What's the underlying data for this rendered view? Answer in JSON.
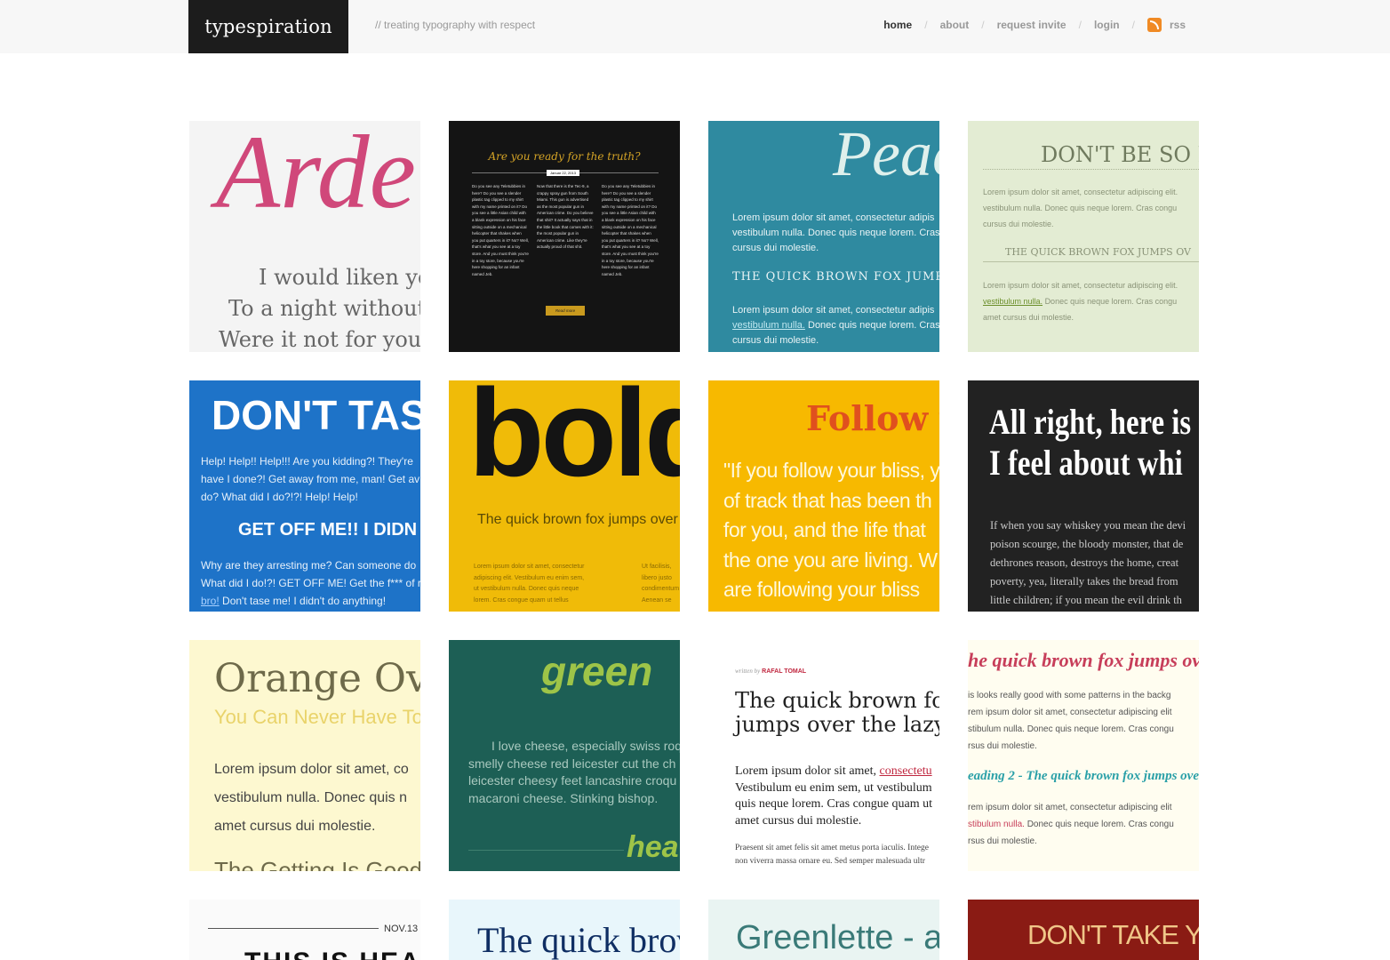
{
  "header": {
    "logo": "typespiration",
    "tagline": "// treating typography with respect",
    "nav": [
      {
        "label": "home"
      },
      {
        "label": "about"
      },
      {
        "label": "request invite"
      },
      {
        "label": "login"
      },
      {
        "label": "rss",
        "icon": "rss-icon"
      }
    ],
    "separator": "/"
  },
  "tiles": {
    "t1": {
      "title": "Ardel",
      "lines": [
        "I would liken yo",
        "To a night without",
        "Were it not for your"
      ],
      "bg": "#f4f4f4",
      "accent": "#d0487a"
    },
    "t2": {
      "title": "Are you ready for the truth?",
      "date": "Januar 22, 2013",
      "col1": "Do you see any Teletubbies in here? Do you see a slender plastic tag clipped to my shirt with my name printed on it? Do you see a little Asian child with a blank expression on his face sitting outside on a mechanical helicopter that shakes when you put quarters in it? No? Well, that's what you see at a toy store. And you must think you're in a toy store, because you're here shopping for an infant named Jeb.",
      "col2": "Now that there is the Tec-9, a crappy spray gun from South Miami. This gun is advertised as the most popular gun in American crime. Do you believe that shit? It actually says that in the little book that comes with it: the most popular gun in American crime. Like they're actually proud of that shit.",
      "button": "Read more",
      "bg": "#141414",
      "accent": "#d4a326"
    },
    "t3": {
      "title": "Peac",
      "p1": [
        "Lorem ipsum dolor sit amet, consectetur adipis",
        "vestibulum nulla. Donec quis neque lorem. Cras",
        "cursus dui molestie."
      ],
      "heading": "THE QUICK BROWN FOX JUMP",
      "p2a": "Lorem ipsum dolor sit amet, consectetur adipis",
      "link": "vestibulum nulla.",
      "p2b": "Donec quis neque lorem. Cras",
      "p2c": "cursus dui molestie.",
      "bg": "#2f8aa0"
    },
    "t4": {
      "title": "DON'T BE SO M",
      "p1": [
        "Lorem ipsum dolor sit amet, consectetur adipiscing elit.",
        "vestibulum nulla. Donec quis neque lorem. Cras congu",
        "cursus dui molestie."
      ],
      "heading": "THE QUICK BROWN FOX JUMPS OV",
      "p2a": "Lorem ipsum dolor sit amet, consectetur adipiscing elit.",
      "link": "vestibulum nulla.",
      "p2b": "Donec quis neque lorem. Cras congu",
      "p2c": "amet cursus dui molestie.",
      "bg": "#e3ecd3"
    },
    "t5": {
      "title": "DON'T TAS",
      "p1": [
        "Help! Help!! Help!!! Are you kidding?! They're",
        "have I done?! Get away from me, man! Get av",
        "do? What did I do?!?! Help! Help!"
      ],
      "heading": "GET OFF ME!! I DIDN",
      "p2": [
        "Why are they arresting me? Can someone do",
        "What did I do!?! GET OFF ME! Get the f*** of r"
      ],
      "link": "bro!",
      "p3": "Don't tase me! I didn't do anything!",
      "bg": "#1e73c8"
    },
    "t6": {
      "title": "bold",
      "sub": "The quick brown fox jumps over",
      "col1": [
        "Lorem ipsum dolor sit amet, consectetur",
        "adipiscing elit. Vestibulum eu enim sem,",
        "ut vestibulum nulla. Donec quis neque",
        "lorem. Cras congue quam ut tellus"
      ],
      "col2": [
        "Ut facilisis,",
        "libero justo",
        "condimentum",
        "Aenean se"
      ],
      "bg": "#f0bb08"
    },
    "t7": {
      "title": "Follow y",
      "lines": [
        "\"If you follow your bliss, y",
        "of track that has been th",
        "for you, and the life that",
        "the one you are living. W",
        "are following your bliss"
      ],
      "bg": "#f7b900",
      "accent": "#e0501e"
    },
    "t8": {
      "title": [
        "All right, here is",
        "I feel about whi"
      ],
      "lines": [
        "If when you say whiskey you mean the devi",
        "poison scourge, the bloody monster, that de",
        "dethrones reason, destroys the home, creat",
        "poverty, yea, literally takes the bread from",
        "little children; if you mean the evil drink th"
      ],
      "bg": "#222222"
    },
    "t9": {
      "title": "Orange Ov",
      "sub": "You Can Never Have To",
      "lines": [
        "Lorem ipsum dolor sit amet, co",
        "vestibulum nulla. Donec quis n",
        "amet cursus dui molestie."
      ],
      "more": "The Getting Is Good",
      "bg": "#fdf8d0",
      "accent": "#e9d36a"
    },
    "t10": {
      "title": "green",
      "lines": [
        "I love cheese, especially swiss roq",
        "smelly cheese red leicester cut the ch",
        "leicester cheesy feet lancashire croqu",
        "macaroni cheese. Stinking bishop."
      ],
      "footer": "hea",
      "bg": "#1d5f55",
      "accent": "#9ec448"
    },
    "t11": {
      "byline": "written by",
      "author": "RAFAL TOMAL",
      "title": [
        "The quick brown fo",
        "jumps over the lazy"
      ],
      "p1a": "Lorem ipsum dolor sit amet,",
      "link": "consectetu",
      "p1": [
        "Vestibulum eu enim sem, ut vestibulum",
        "quis neque lorem. Cras congue quam ut",
        "amet cursus dui molestie."
      ],
      "p2": [
        "Praesent sit amet felis sit amet metus porta iaculis. Intege",
        "non viverra massa ornare eu. Sed semper malesuada ultr"
      ],
      "bg": "#ffffff",
      "accent": "#c0273f"
    },
    "t12": {
      "title": "he quick brown fox jumps ov",
      "p1": [
        "is looks really good with some patterns in the backg",
        "rem ipsum dolor sit amet, consectetur adipiscing elit",
        "stibulum nulla. Donec quis neque lorem. Cras congu",
        "rsus dui molestie."
      ],
      "heading": "eading 2 - The quick brown fox jumps over",
      "p2a": "rem ipsum dolor sit amet, consectetur adipiscing elit",
      "link": "stibulum nulla.",
      "p2b": "Donec quis neque lorem. Cras congu",
      "p2c": "rsus dui molestie.",
      "bg": "#fffdf0",
      "accent": "#c73e5a",
      "accent2": "#2aa0a8"
    },
    "t13": {
      "date": "NOV.13",
      "title": "THIS IS HEA",
      "bg": "#fafafa"
    },
    "t14": {
      "title": "The quick brov",
      "bg": "#e8f6fb",
      "accent": "#0f2e63"
    },
    "t15": {
      "title": "Greenlette - a",
      "bg": "#e9f4f2",
      "accent": "#3a7a78"
    },
    "t16": {
      "title": "DON'T TAKE Y",
      "bg": "#8a1b14",
      "accent": "#f0c688"
    }
  }
}
